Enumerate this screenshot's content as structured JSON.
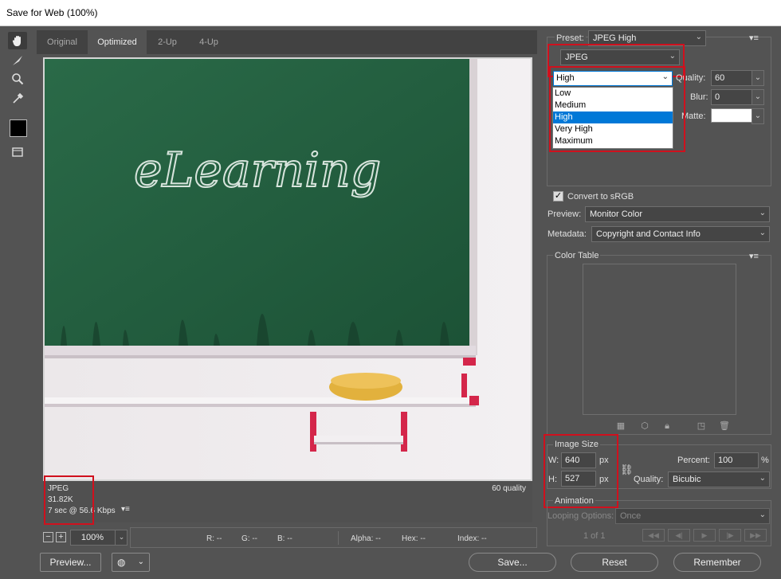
{
  "window": {
    "title": "Save for Web (100%)"
  },
  "tabs": [
    {
      "label": "Original"
    },
    {
      "label": "Optimized"
    },
    {
      "label": "2-Up"
    },
    {
      "label": "4-Up"
    }
  ],
  "image": {
    "chalk_text": "eLearning"
  },
  "info": {
    "format": "JPEG",
    "size": "31.82K",
    "speed": "7 sec @ 56.6 Kbps",
    "quality_note": "60 quality"
  },
  "status": {
    "zoom": "100%",
    "r": "R: --",
    "g": "G: --",
    "b": "B: --",
    "alpha": "Alpha: --",
    "hex": "Hex: --",
    "index": "Index: --"
  },
  "buttons": {
    "preview": "Preview...",
    "save": "Save...",
    "reset": "Reset",
    "remember": "Remember"
  },
  "settings": {
    "preset_label": "Preset:",
    "preset_value": "JPEG High",
    "format_value": "JPEG",
    "quality_level": "High",
    "quality_label": "Quality:",
    "quality_value": "60",
    "blur_label": "Blur:",
    "blur_value": "0",
    "matte_label": "Matte:",
    "quality_options": [
      "Low",
      "Medium",
      "High",
      "Very High",
      "Maximum"
    ],
    "convert_srgb": "Convert to sRGB",
    "preview_label": "Preview:",
    "preview_value": "Monitor Color",
    "metadata_label": "Metadata:",
    "metadata_value": "Copyright and Contact Info"
  },
  "color_table": {
    "title": "Color Table"
  },
  "image_size": {
    "title": "Image Size",
    "w_label": "W:",
    "w_value": "640",
    "h_label": "H:",
    "h_value": "527",
    "unit": "px",
    "percent_label": "Percent:",
    "percent_value": "100",
    "percent_unit": "%",
    "quality_label": "Quality:",
    "quality_value": "Bicubic"
  },
  "animation": {
    "title": "Animation",
    "looping_label": "Looping Options:",
    "looping_value": "Once",
    "frame_counter": "1 of 1"
  },
  "colors": {
    "accent": "#0078d7",
    "highlight_box": "#d0101d",
    "chalkboard": "#1f5a3a"
  }
}
